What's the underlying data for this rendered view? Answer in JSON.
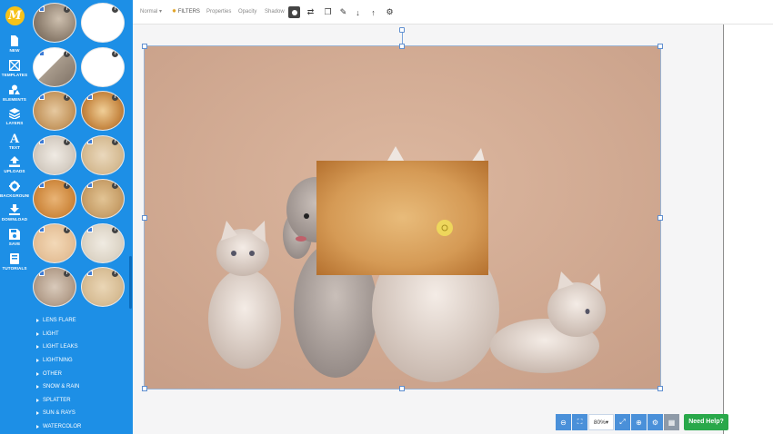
{
  "app": {
    "logo_letter": "M"
  },
  "rail": [
    {
      "key": "new",
      "label": "NEW",
      "icon": "document-icon"
    },
    {
      "key": "templates",
      "label": "TEMPLATES",
      "icon": "templates-icon"
    },
    {
      "key": "elements",
      "label": "ELEMENTS",
      "icon": "shapes-icon"
    },
    {
      "key": "layers",
      "label": "LAYERS",
      "icon": "layers-icon"
    },
    {
      "key": "text",
      "label": "TEXT",
      "icon": "text-icon"
    },
    {
      "key": "uploads",
      "label": "UPLOADS",
      "icon": "upload-icon"
    },
    {
      "key": "background",
      "label": "BACKGROUND",
      "icon": "gear-icon"
    },
    {
      "key": "download",
      "label": "DOWNLOAD",
      "icon": "download-icon"
    },
    {
      "key": "save",
      "label": "SAVE",
      "icon": "save-icon"
    },
    {
      "key": "tutorials",
      "label": "TUTORIALS",
      "icon": "book-icon"
    }
  ],
  "categories": [
    "LENS FLARE",
    "LIGHT",
    "LIGHT LEAKS",
    "LIGHTNING",
    "OTHER",
    "SNOW & RAIN",
    "SPLATTER",
    "SUN & RAYS",
    "WATERCOLOR"
  ],
  "toolbar": {
    "blend_mode": "Normal",
    "filters_label": "FILTERS",
    "properties_label": "Properties",
    "opacity_label": "Opacity",
    "shadow_label": "Shadow"
  },
  "zoom": {
    "value": "80%"
  },
  "help": {
    "label": "Need Help?"
  },
  "colors": {
    "accent": "#1d8fe6",
    "help_green": "#29a84a"
  }
}
